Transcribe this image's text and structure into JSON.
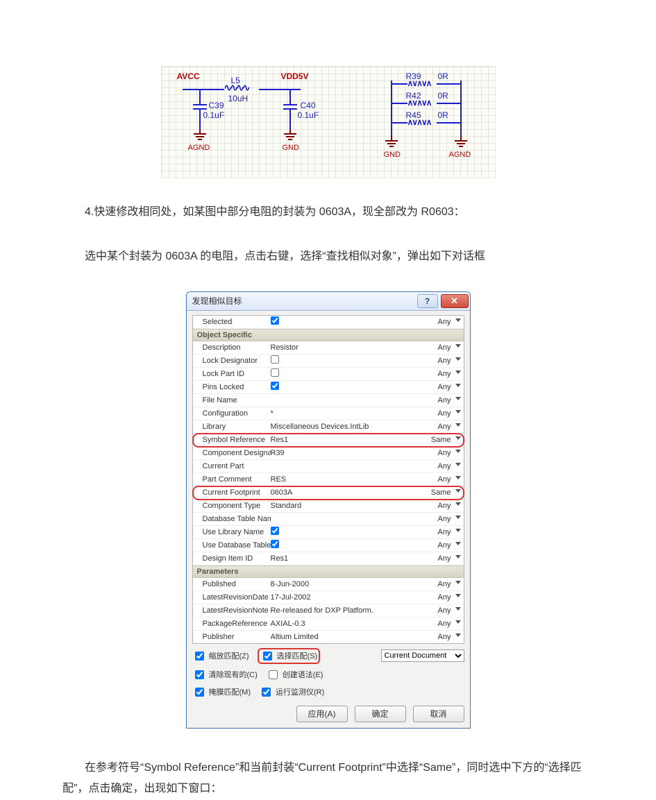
{
  "text": {
    "p1": "4.快速修改相同处，如某图中部分电阻的封装为 0603A，现全部改为 R0603：",
    "p2": "选中某个封装为 0603A 的电阻，点击右键，选择“查找相似对象”，弹出如下对话框",
    "p3": "在参考符号“Symbol Reference”和当前封装“Current Footprint”中选择“Same”，同时选中下方的“选择匹配”，点击确定，出现如下窗口："
  },
  "schematic": {
    "left": {
      "nets": {
        "avcc": "AVCC",
        "vdd5v": "VDD5V",
        "agnd": "AGND",
        "gnd": "GND"
      },
      "l5": {
        "ref": "L5",
        "value": "10uH"
      },
      "c39": {
        "ref": "C39",
        "value": "0.1uF"
      },
      "c40": {
        "ref": "C40",
        "value": "0.1uF"
      }
    },
    "right": {
      "nets": {
        "gnd": "GND",
        "agnd": "AGND"
      },
      "r39": {
        "ref": "R39",
        "value": "0R"
      },
      "r42": {
        "ref": "R42",
        "value": "0R"
      },
      "r45": {
        "ref": "R45",
        "value": "0R"
      }
    }
  },
  "dialog": {
    "title": "发现相似目标",
    "sections": {
      "objectSpecific": "Object Specific",
      "parameters": "Parameters"
    },
    "rows": [
      {
        "label": "Selected",
        "value": "",
        "match": "Any"
      },
      {
        "label": "Description",
        "value": "Resistor",
        "match": "Any"
      },
      {
        "label": "Lock Designator",
        "value": "",
        "match": "Any"
      },
      {
        "label": "Lock Part ID",
        "value": "",
        "match": "Any"
      },
      {
        "label": "Pins Locked",
        "value": "",
        "match": "Any"
      },
      {
        "label": "File Name",
        "value": "",
        "match": "Any"
      },
      {
        "label": "Configuration",
        "value": "*",
        "match": "Any"
      },
      {
        "label": "Library",
        "value": "Miscellaneous Devices.IntLib",
        "match": "Any"
      },
      {
        "label": "Symbol Reference",
        "value": "Res1",
        "match": "Same"
      },
      {
        "label": "Component Designator",
        "value": "R39",
        "match": "Any"
      },
      {
        "label": "Current Part",
        "value": "",
        "match": "Any"
      },
      {
        "label": "Part Comment",
        "value": "RES",
        "match": "Any"
      },
      {
        "label": "Current Footprint",
        "value": "0603A",
        "match": "Same"
      },
      {
        "label": "Component Type",
        "value": "Standard",
        "match": "Any"
      },
      {
        "label": "Database Table Name",
        "value": "",
        "match": "Any"
      },
      {
        "label": "Use Library Name",
        "value": "",
        "match": "Any"
      },
      {
        "label": "Use Database Table Na",
        "value": "",
        "match": "Any"
      },
      {
        "label": "Design Item ID",
        "value": "Res1",
        "match": "Any"
      },
      {
        "label": "Published",
        "value": "8-Jun-2000",
        "match": "Any"
      },
      {
        "label": "LatestRevisionDate",
        "value": "17-Jul-2002",
        "match": "Any"
      },
      {
        "label": "LatestRevisionNote",
        "value": "Re-released for DXP Platform.",
        "match": "Any"
      },
      {
        "label": "PackageReference",
        "value": "AXIAL-0.3",
        "match": "Any"
      },
      {
        "label": "Publisher",
        "value": "Altium Limited",
        "match": "Any"
      }
    ],
    "options": {
      "zoomMatch": "缩放匹配(Z)",
      "selectMatch": "选择匹配(S)",
      "clearExisting": "清除现有的(C)",
      "createExpr": "创建语法(E)",
      "maskMatch": "掩膜匹配(M)",
      "runInspector": "运行监测仪(R)",
      "scope": "Current Document"
    },
    "buttons": {
      "apply": "应用(A)",
      "ok": "确定",
      "cancel": "取消"
    }
  }
}
